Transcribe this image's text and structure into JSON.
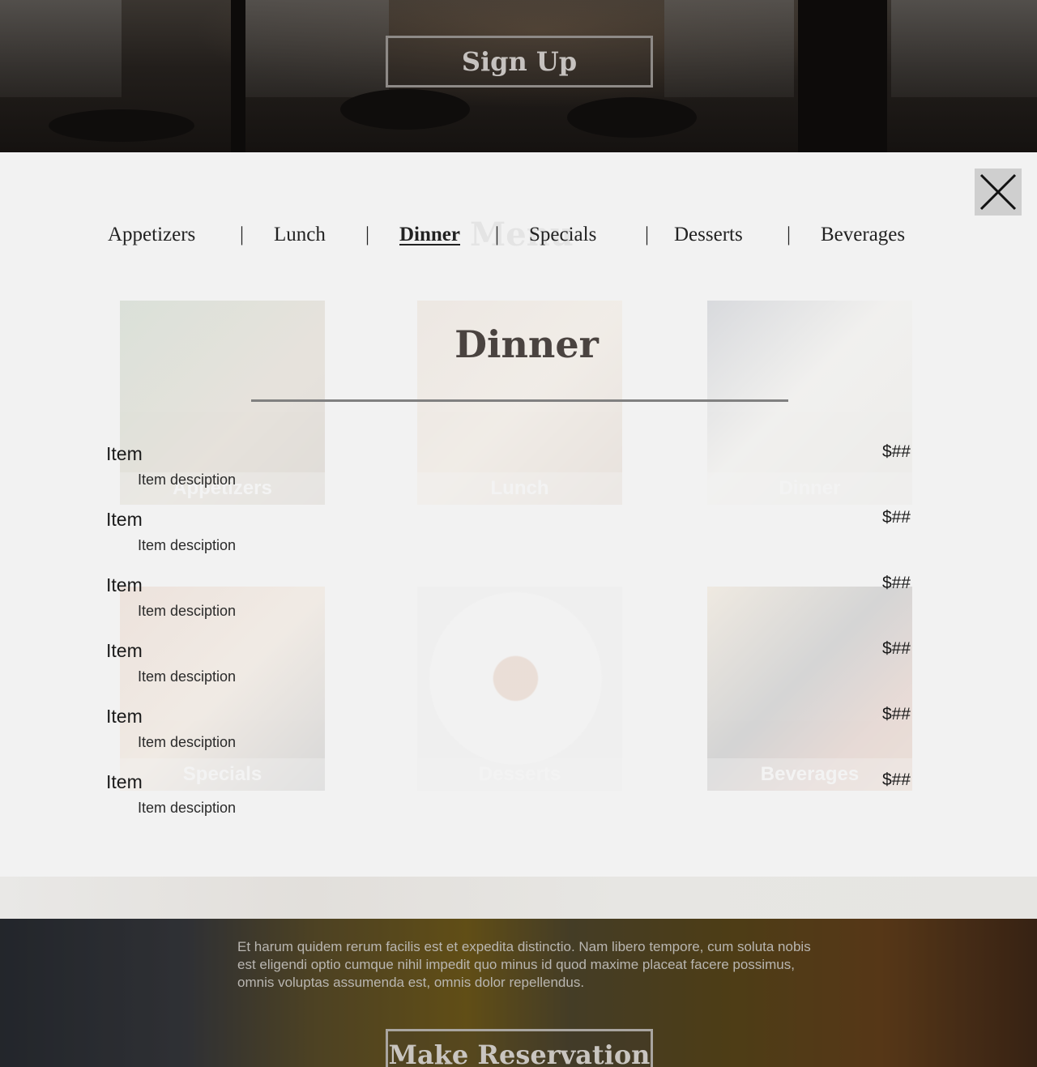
{
  "hero": {
    "signup_label": "Sign Up"
  },
  "modal": {
    "ghost_title": "Menu",
    "tabs": [
      {
        "label": "Appetizers"
      },
      {
        "label": "Lunch"
      },
      {
        "label": "Dinner",
        "active": true
      },
      {
        "label": "Specials"
      },
      {
        "label": "Desserts"
      },
      {
        "label": "Beverages"
      }
    ],
    "separator": "|",
    "cards": [
      {
        "label": "Appetizers"
      },
      {
        "label": "Lunch"
      },
      {
        "label": "Dinner"
      },
      {
        "label": "Specials"
      },
      {
        "label": "Desserts"
      },
      {
        "label": "Beverages"
      }
    ],
    "title": "Dinner",
    "items": [
      {
        "name": "Item",
        "description": "Item desciption",
        "price": "$##"
      },
      {
        "name": "Item",
        "description": "Item desciption",
        "price": "$##"
      },
      {
        "name": "Item",
        "description": "Item desciption",
        "price": "$##"
      },
      {
        "name": "Item",
        "description": "Item desciption",
        "price": "$##"
      },
      {
        "name": "Item",
        "description": "Item desciption",
        "price": "$##"
      },
      {
        "name": "Item",
        "description": "Item desciption",
        "price": "$##"
      }
    ]
  },
  "footer_hero": {
    "text": "Et harum quidem rerum facilis est et expedita distinctio. Nam libero tempore, cum soluta nobis est eligendi optio cumque nihil impedit quo minus id quod maxime placeat facere possimus, omnis voluptas assumenda est, omnis dolor repellendus.",
    "reserve_label": "Make Reservation"
  },
  "colors": {
    "modal_bg": "#f2f2f2",
    "title": "#4a4340",
    "rule": "#808080",
    "close_bg": "#cfcfcf"
  },
  "icons": {
    "close": "close-icon"
  }
}
